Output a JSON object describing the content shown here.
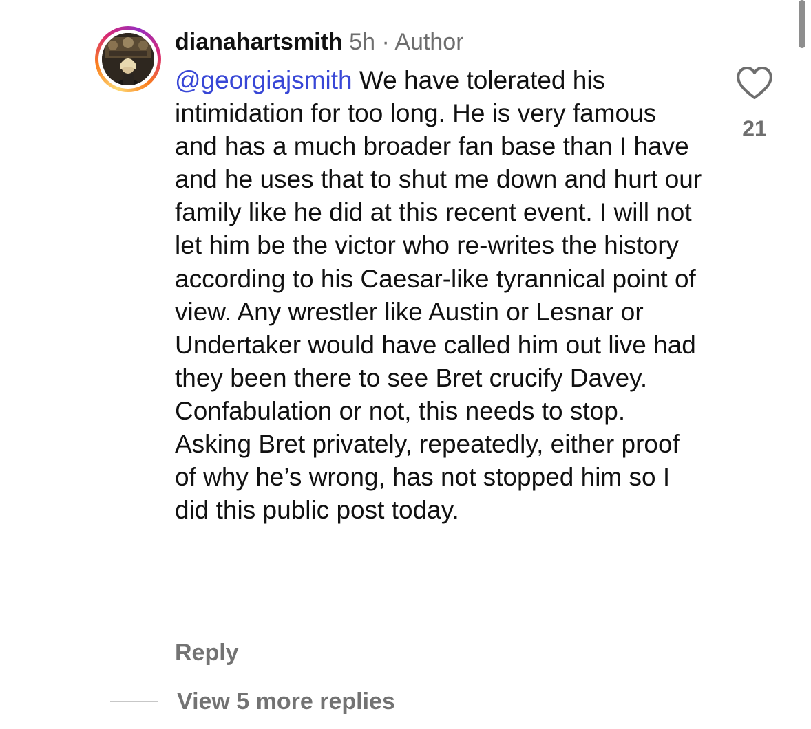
{
  "comment": {
    "username": "dianahartsmith",
    "age": "5h",
    "separator": " · ",
    "role_label": "Author",
    "mention": "@georgiajsmith",
    "text": " We have tolerated his intimidation for too long. He is very famous and has a much broader fan base than I have and he uses that to shut me down and hurt our family like he did at this recent event. I will not let him be the victor who re-writes the history according to his Caesar-like tyrannical point of view. Any wrestler like Austin or Lesnar or Undertaker would have called him out live had they been there to see Bret crucify Davey. Confabulation or not, this needs to stop. Asking Bret privately, repeatedly, either proof of why he’s wrong, has not stopped him so I did this public post today.",
    "like_count": "21",
    "reply_label": "Reply",
    "view_replies_label": "View 5 more replies"
  },
  "icons": {
    "like": "heart-outline-icon",
    "avatar": "profile-avatar"
  },
  "colors": {
    "mention": "#3847d6",
    "secondary_text": "#737373",
    "ring_gradient": [
      "#feda75",
      "#fa7e1e",
      "#d62976",
      "#962fbf"
    ]
  }
}
